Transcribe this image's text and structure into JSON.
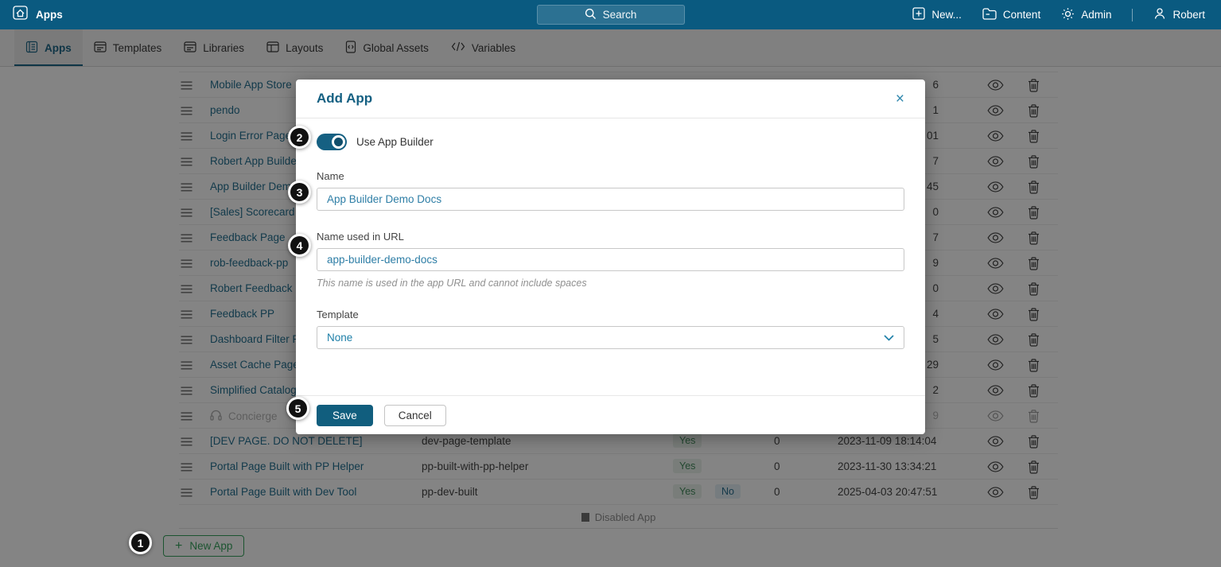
{
  "topbar": {
    "title": "Apps",
    "search_placeholder": "Search",
    "new_label": "New...",
    "content_label": "Content",
    "admin_label": "Admin",
    "user_label": "Robert"
  },
  "tabs": [
    {
      "label": "Apps",
      "active": true
    },
    {
      "label": "Templates",
      "active": false
    },
    {
      "label": "Libraries",
      "active": false
    },
    {
      "label": "Layouts",
      "active": false
    },
    {
      "label": "Global Assets",
      "active": false
    },
    {
      "label": "Variables",
      "active": false
    }
  ],
  "table": {
    "rows": [
      {
        "name": "Mobile App Store",
        "date": "6"
      },
      {
        "name": "pendo",
        "date": "1"
      },
      {
        "name": "Login Error Page",
        "date": "01"
      },
      {
        "name": "Robert App Builder",
        "date": "7"
      },
      {
        "name": "App Builder Dem",
        "date": "45"
      },
      {
        "name": "[Sales] Scorecard",
        "date": "0"
      },
      {
        "name": "Feedback Page",
        "date": "7"
      },
      {
        "name": "rob-feedback-pp",
        "date": "9"
      },
      {
        "name": "Robert Feedback Pl",
        "date": "0"
      },
      {
        "name": "Feedback PP",
        "date": "4"
      },
      {
        "name": "Dashboard Filter Pa",
        "date": "5"
      },
      {
        "name": "Asset Cache Page",
        "date": "29"
      },
      {
        "name": "Simplified Catalog",
        "date": "2"
      },
      {
        "name": "Concierge",
        "date": "9",
        "disabled": true
      },
      {
        "name": "[DEV PAGE. DO NOT DELETE]",
        "slug": "dev-page-template",
        "enabled": "Yes",
        "count": "0",
        "date": "2023-11-09 18:14:04"
      },
      {
        "name": "Portal Page Built with PP Helper",
        "slug": "pp-built-with-pp-helper",
        "enabled": "Yes",
        "count": "0",
        "date": "2023-11-30 13:34:21"
      },
      {
        "name": "Portal Page Built with Dev Tool",
        "slug": "pp-dev-built",
        "enabled": "Yes",
        "builder": "No",
        "count": "0",
        "date": "2025-04-03 20:47:51"
      }
    ],
    "legend_label": "Disabled App",
    "new_app_label": "New App",
    "new_app_plus": "+"
  },
  "modal": {
    "title": "Add App",
    "close_icon": "×",
    "toggle_label": "Use App Builder",
    "toggle_on": true,
    "name_label": "Name",
    "name_value": "App Builder Demo Docs",
    "url_label": "Name used in URL",
    "url_value": "app-builder-demo-docs",
    "url_help": "This name is used in the app URL and cannot include spaces",
    "template_label": "Template",
    "template_value": "None",
    "save_label": "Save",
    "cancel_label": "Cancel"
  },
  "callouts": [
    {
      "label": "1"
    },
    {
      "label": "2"
    },
    {
      "label": "3"
    },
    {
      "label": "4"
    },
    {
      "label": "5"
    }
  ],
  "colors": {
    "topbar_bg": "#0a5a80",
    "accent_teal": "#156082",
    "link_teal": "#1b6a8c",
    "save_button": "#115e7e",
    "new_app_green": "#2e9e57",
    "yes_badge_text": "#3c8757",
    "yes_badge_bg": "#e9f1ea",
    "no_badge_text": "#20688a",
    "no_badge_bg": "#e3eef4",
    "overlay": "rgba(10,10,10,0.5)"
  }
}
